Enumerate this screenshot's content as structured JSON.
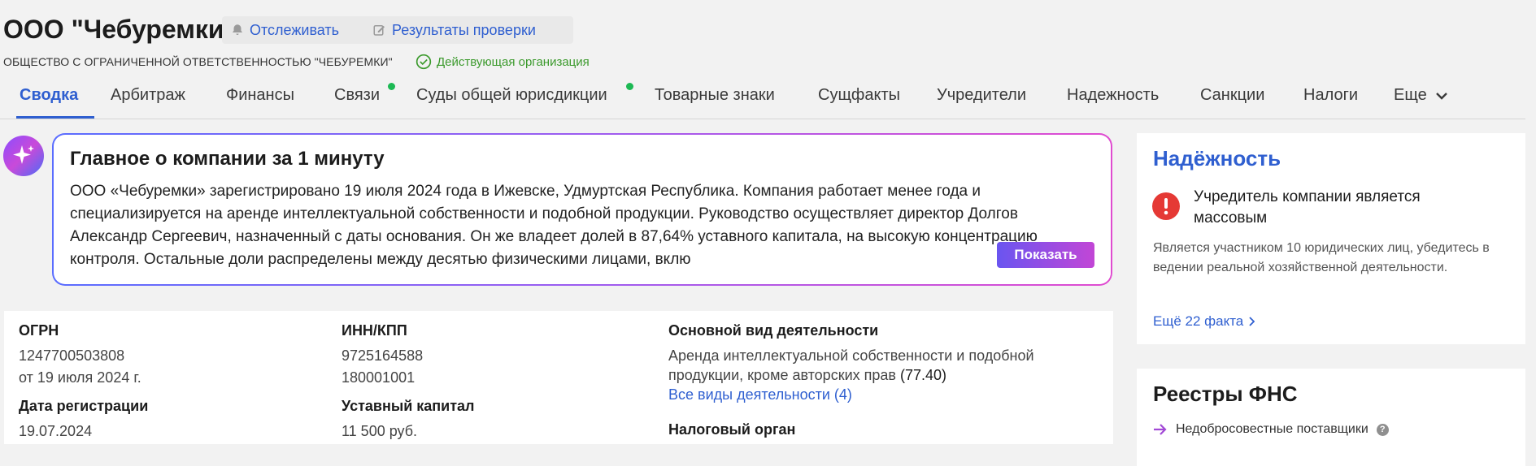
{
  "header": {
    "company_title": "ООО \"Чебуремки\"",
    "track_label": "Отслеживать",
    "check_label": "Результаты проверки",
    "legal_name": "ОБЩЕСТВО С ОГРАНИЧЕННОЙ ОТВЕТСТВЕННОСТЬЮ \"ЧЕБУРЕМКИ\"",
    "status": "Действующая организация"
  },
  "tabs": [
    {
      "label": "Сводка",
      "active": true
    },
    {
      "label": "Арбитраж"
    },
    {
      "label": "Финансы"
    },
    {
      "label": "Связи",
      "dot": true
    },
    {
      "label": "Суды общей юрисдикции",
      "dot": true
    },
    {
      "label": "Товарные знаки"
    },
    {
      "label": "Сущфакты"
    },
    {
      "label": "Учредители"
    },
    {
      "label": "Надежность"
    },
    {
      "label": "Санкции"
    },
    {
      "label": "Налоги"
    },
    {
      "label": "Еще"
    }
  ],
  "ai_summary": {
    "title": "Главное о компании за 1 минуту",
    "text": "ООО «Чебуремки» зарегистрировано 19 июля 2024 года в Ижевске, Удмуртская Республика. Компания работает менее года и специализируется на аренде интеллектуальной собственности и подобной продукции. Руководство осуществляет директор Долгов Александр Сергеевич, назначенный с даты основания. Он же владеет долей в 87,64% уставного капитала, на высокую концентрацию контроля. Остальные доли распределены между десятью физическими лицами, вклю",
    "show_label": "Показать"
  },
  "info": {
    "ogrn_label": "ОГРН",
    "ogrn_value": "1247700503808",
    "ogrn_date": "от 19 июля 2024 г.",
    "reg_date_label": "Дата регистрации",
    "reg_date_value": "19.07.2024",
    "inn_label": "ИНН/КПП",
    "inn_value": "9725164588",
    "kpp_value": "180001001",
    "capital_label": "Уставный капитал",
    "capital_value": "11 500 руб.",
    "activity_label": "Основной вид деятельности",
    "activity_line1": "Аренда интеллектуальной собственности и подобной",
    "activity_line2": "продукции, кроме авторских прав",
    "activity_code": "(77.40)",
    "all_activities_link": "Все виды деятельности (4)",
    "tax_label": "Налоговый орган"
  },
  "reliability": {
    "title": "Надёжность",
    "warning_head": "Учредитель компании является массовым",
    "warning_text": "Является участником 10 юридических лиц, убедитесь в ведении реальной хозяйственной деятельности.",
    "more_link": "Ещё 22 факта"
  },
  "fns": {
    "title": "Реестры ФНС",
    "item": "Недобросовестные поставщики"
  }
}
